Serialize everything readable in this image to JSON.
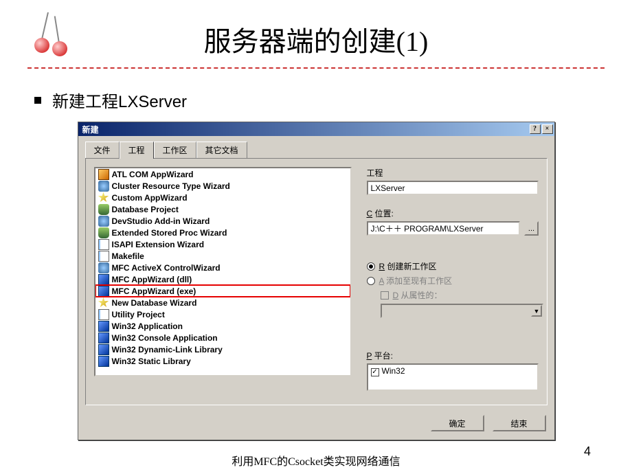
{
  "slide": {
    "title": "服务器端的创建(1)",
    "bullet": "新建工程LXServer",
    "footer": "利用MFC的Csocket类实现网络通信",
    "page_number": "4"
  },
  "dialog": {
    "title": "新建",
    "title_help": "?",
    "title_close": "×",
    "tabs": [
      "文件",
      "工程",
      "工作区",
      "其它文档"
    ],
    "list_items": [
      "ATL COM AppWizard",
      "Cluster Resource Type Wizard",
      "Custom AppWizard",
      "Database Project",
      "DevStudio Add-in Wizard",
      "Extended Stored Proc Wizard",
      "ISAPI Extension Wizard",
      "Makefile",
      "MFC ActiveX ControlWizard",
      "MFC AppWizard (dll)",
      "MFC AppWizard (exe)",
      "New Database Wizard",
      "Utility Project",
      "Win32 Application",
      "Win32 Console Application",
      "Win32 Dynamic-Link Library",
      "Win32 Static Library"
    ],
    "right": {
      "project_label": "工程",
      "project_value": "LXServer",
      "location_label_u": "C",
      "location_label": " 位置:",
      "location_value": "J:\\C＋＋ PROGRAM\\LXServer",
      "browse": "...",
      "radio_r_u": "R",
      "radio_r": " 创建新工作区",
      "radio_a_u": "A",
      "radio_a": " 添加至现有工作区",
      "check_d_u": "D",
      "check_d": " 从属性的：",
      "platform_label_u": "P",
      "platform_label": " 平台:",
      "platform_value": "Win32",
      "platform_check": "✓"
    },
    "buttons": {
      "ok": "确定",
      "cancel": "结束"
    }
  }
}
